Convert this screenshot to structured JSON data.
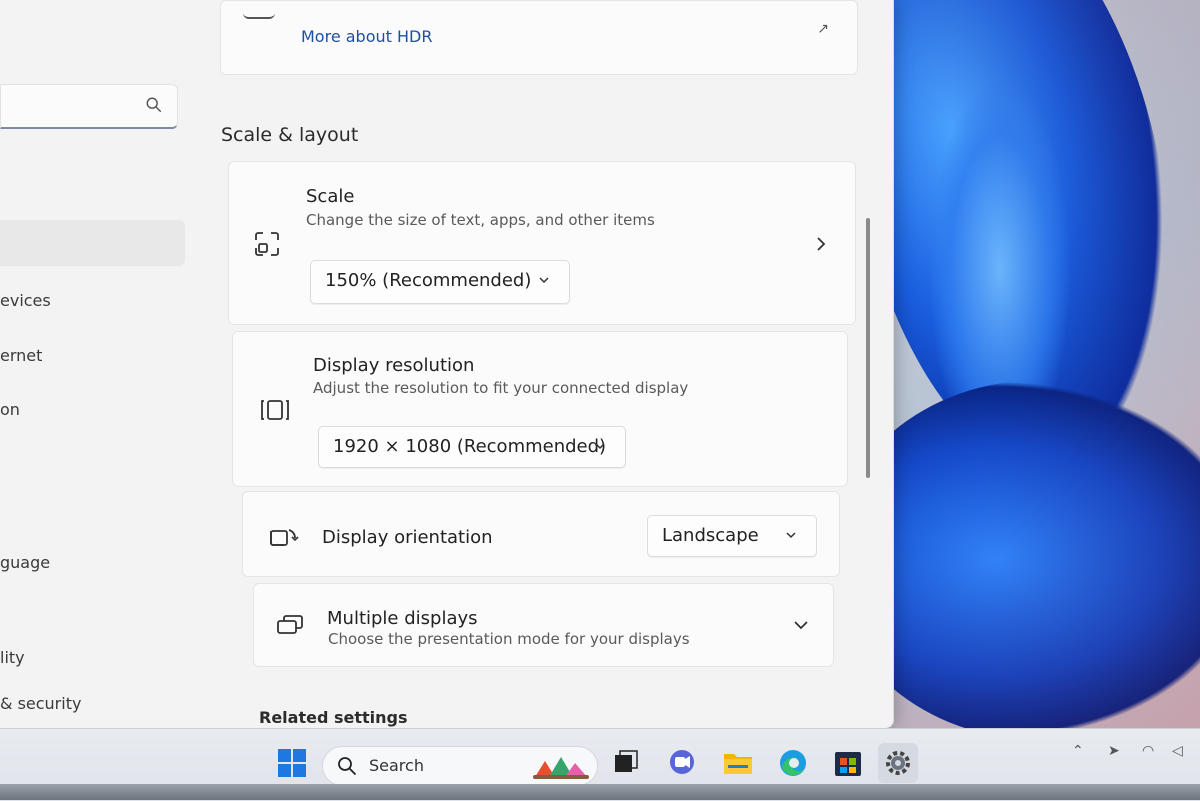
{
  "nav": {
    "search_placeholder": "",
    "items": [
      {
        "label": "evices"
      },
      {
        "label": "ernet"
      },
      {
        "label": "on"
      },
      {
        "label": "guage"
      },
      {
        "label": "lity"
      },
      {
        "label": "& security"
      }
    ]
  },
  "hdr": {
    "link": "More about HDR"
  },
  "section_title": "Scale & layout",
  "scale": {
    "title": "Scale",
    "desc": "Change the size of text, apps, and other items",
    "value": "150% (Recommended)"
  },
  "resolution": {
    "title": "Display resolution",
    "desc": "Adjust the resolution to fit your connected display",
    "value": "1920 × 1080 (Recommended)"
  },
  "orientation": {
    "title": "Display orientation",
    "value": "Landscape"
  },
  "multiple": {
    "title": "Multiple displays",
    "desc": "Choose the presentation mode for your displays"
  },
  "related_title": "Related settings",
  "taskbar": {
    "search_label": "Search",
    "apps": [
      "start-icon",
      "search-icon",
      "widgets-icon",
      "task-view-icon",
      "chat-icon",
      "file-explorer-icon",
      "edge-icon",
      "store-icon",
      "settings-icon"
    ]
  },
  "colors": {
    "accent": "#1f4fa3",
    "window_bg": "#f3f3f3",
    "card_bg": "#fbfbfb"
  }
}
